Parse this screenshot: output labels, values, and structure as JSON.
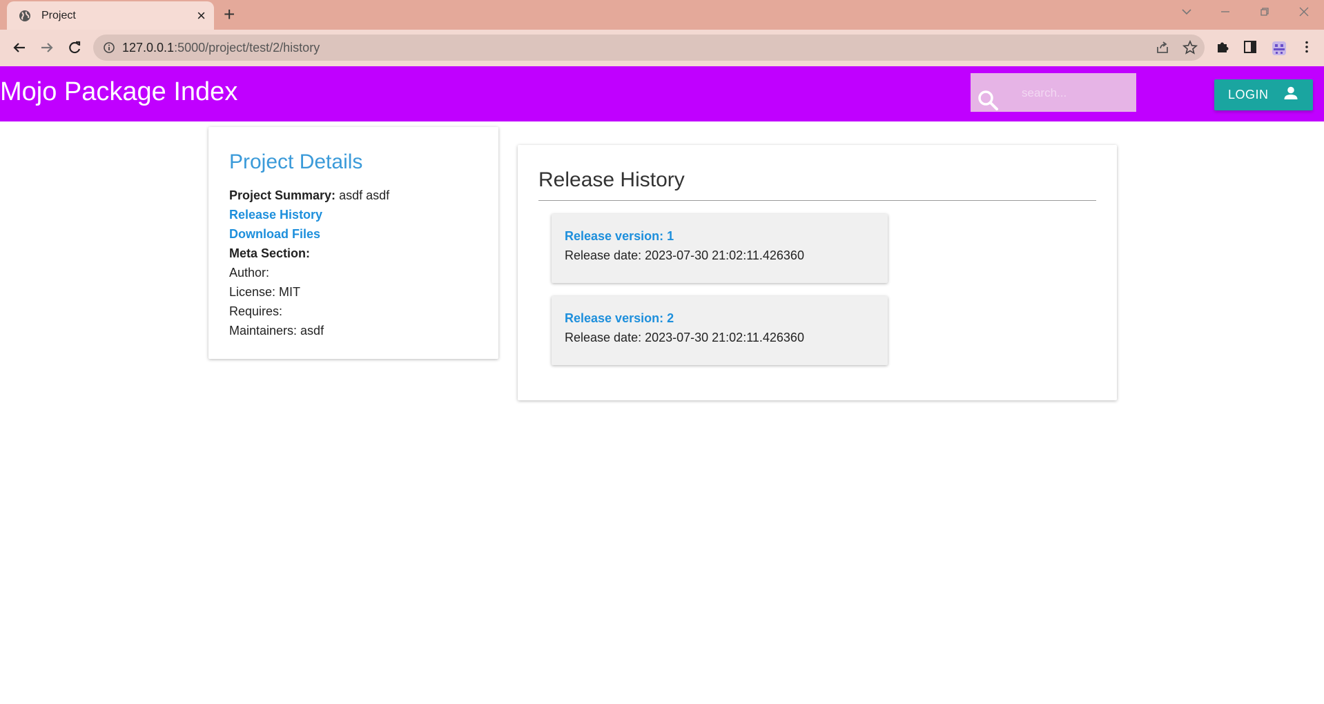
{
  "browser": {
    "tab_title": "Project",
    "url_host": "127.0.0.1",
    "url_rest": ":5000/project/test/2/history"
  },
  "header": {
    "brand": "Mojo Package Index",
    "search_placeholder": "search...",
    "login_label": "LOGIN"
  },
  "details": {
    "heading": "Project Details",
    "summary_label": "Project Summary:",
    "summary_value": " asdf asdf",
    "release_history_link": "Release History",
    "download_files_link": "Download Files",
    "meta_label": "Meta Section:",
    "author": "Author:",
    "license": "License: MIT",
    "requires": "Requires:",
    "maintainers": "Maintainers: asdf"
  },
  "history": {
    "heading": "Release History",
    "releases": [
      {
        "version": "Release version: 1",
        "date": "Release date: 2023-07-30 21:02:11.426360"
      },
      {
        "version": "Release version: 2",
        "date": "Release date: 2023-07-30 21:02:11.426360"
      }
    ]
  },
  "colors": {
    "appbar": "#c000ff",
    "login_button": "#1aa5a0",
    "link": "#1d8fdc",
    "tabbar": "#e4a99a"
  }
}
